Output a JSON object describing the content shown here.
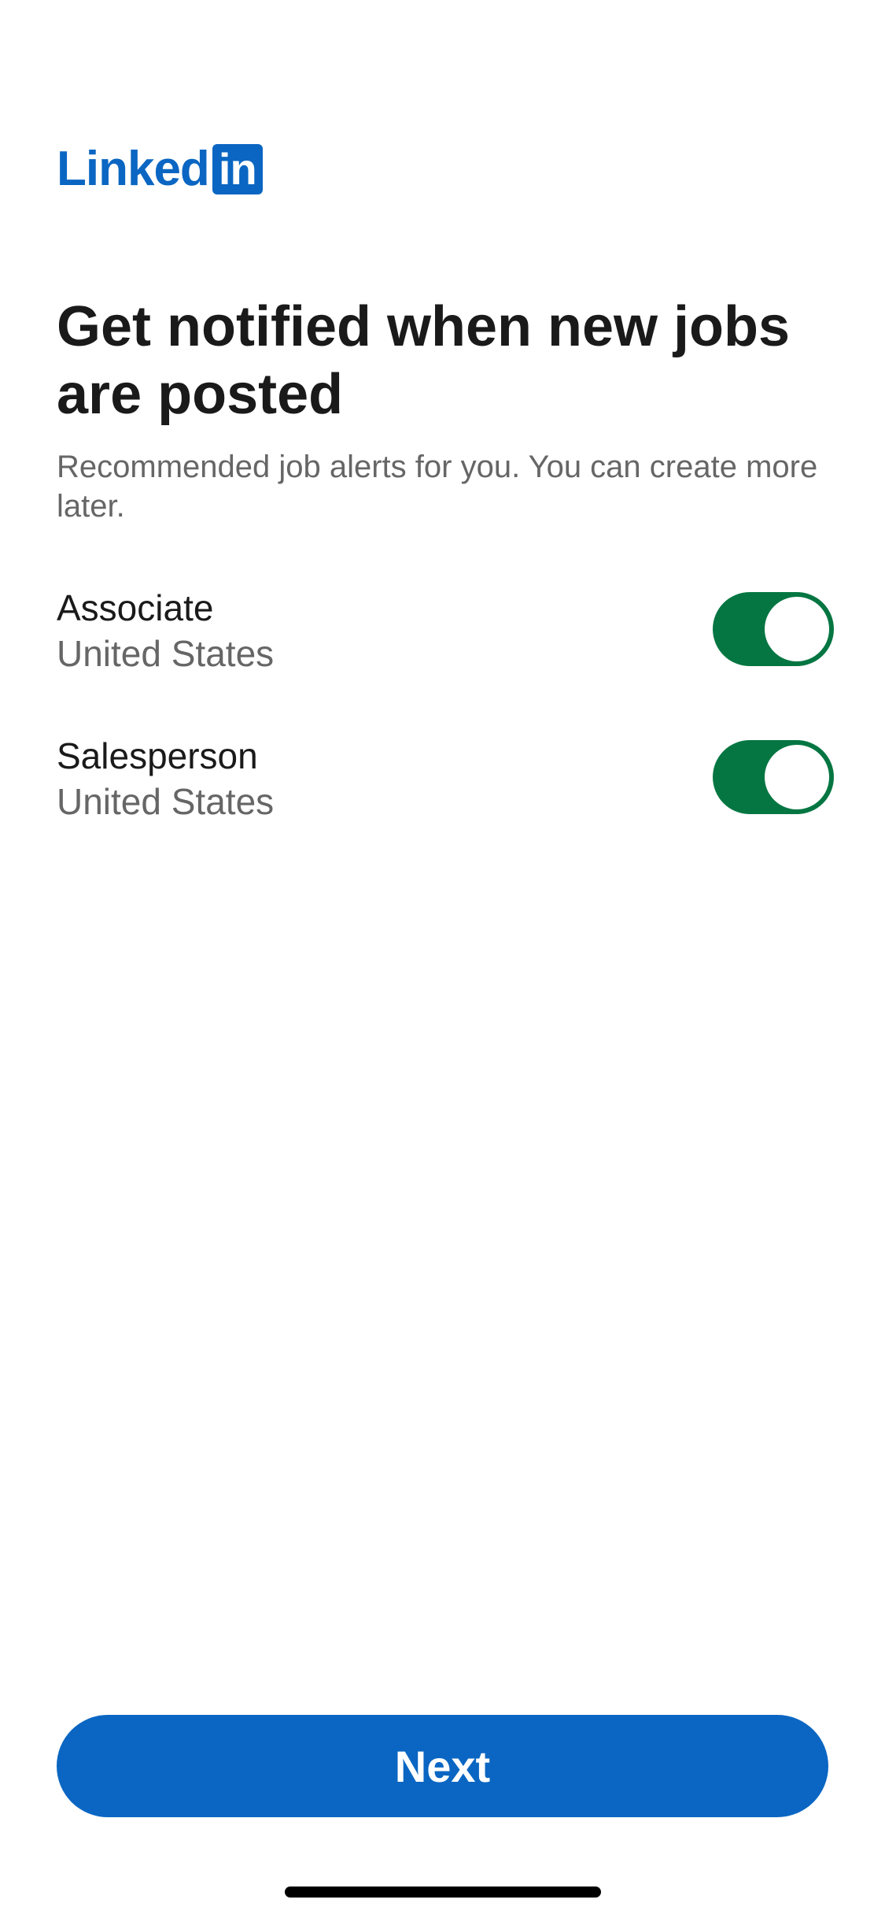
{
  "brand": {
    "wordmark": "Linked",
    "box_text": "in",
    "color": "#0a66c2"
  },
  "heading": "Get notified when new jobs are posted",
  "subtitle": "Recommended job alerts for you. You can create more later.",
  "alerts": [
    {
      "title": "Associate",
      "location": "United States",
      "enabled": true
    },
    {
      "title": "Salesperson",
      "location": "United States",
      "enabled": true
    }
  ],
  "toggle_on_color": "#057642",
  "next_button": {
    "label": "Next",
    "color": "#0a66c2"
  }
}
